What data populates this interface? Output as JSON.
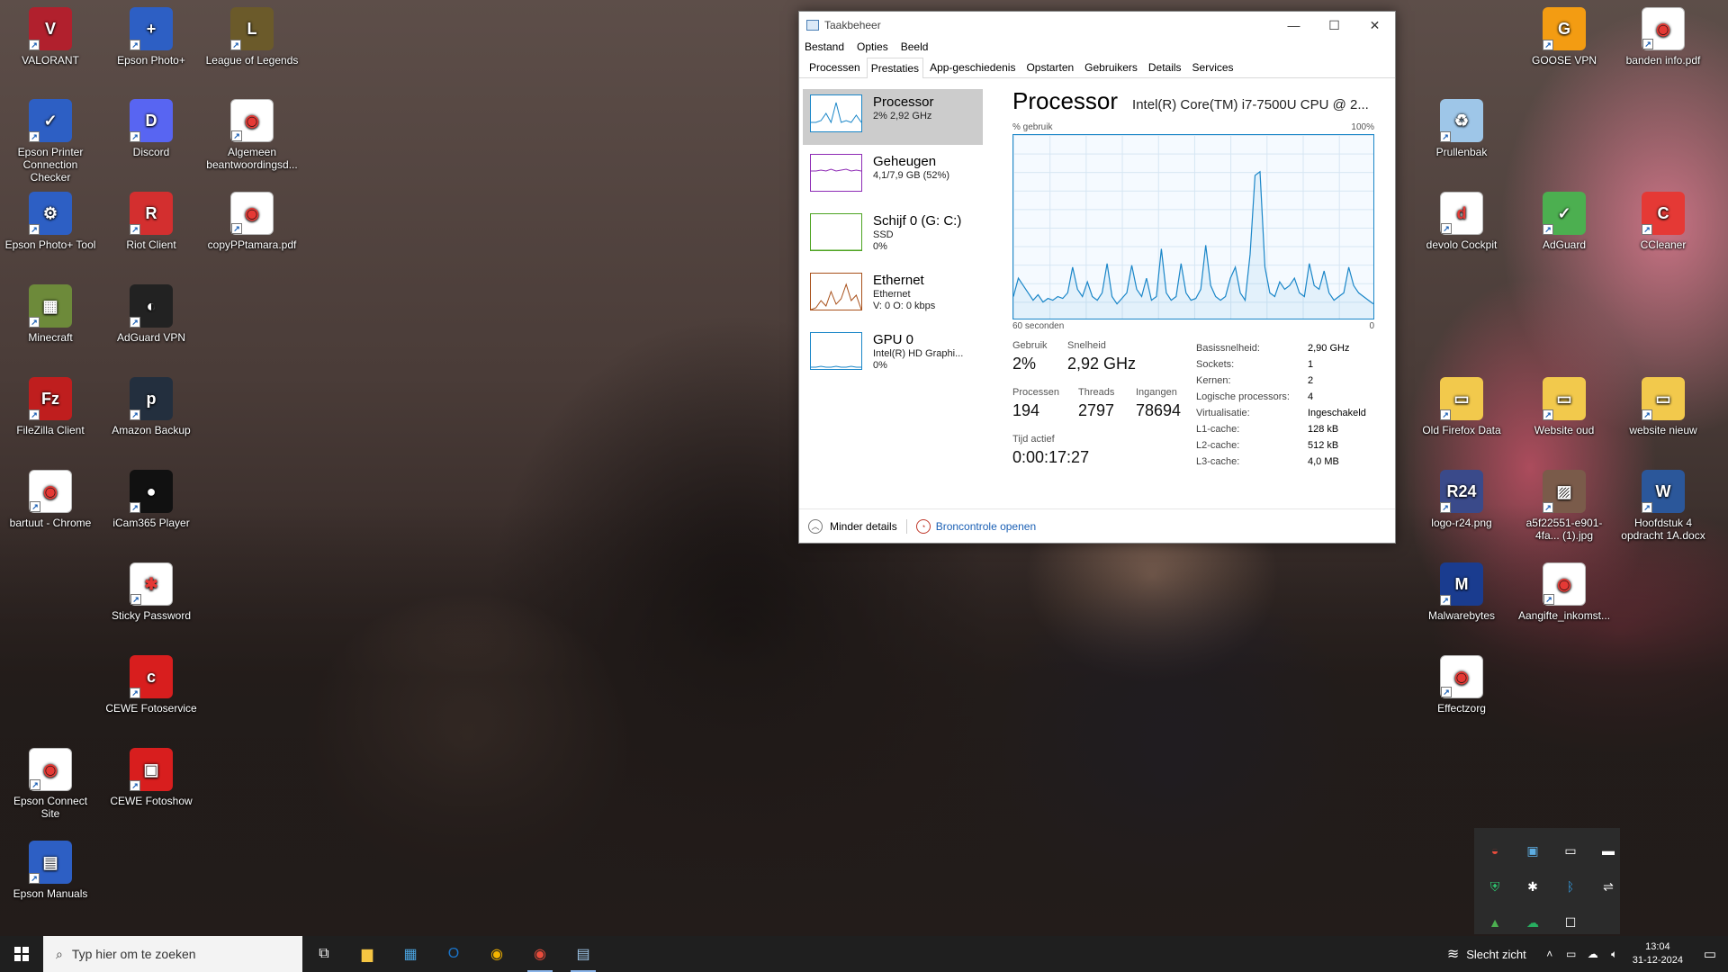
{
  "desktop": {
    "icons": [
      {
        "label": "VALORANT",
        "color": "#b1202d",
        "glyph": "V"
      },
      {
        "label": "Epson Photo+",
        "color": "#2d5fc4",
        "glyph": "+"
      },
      {
        "label": "League of Legends",
        "color": "#6b5a2a",
        "glyph": "L"
      },
      {
        "label": "Epson Printer Connection Checker",
        "color": "#2d5fc4",
        "glyph": "✓"
      },
      {
        "label": "Discord",
        "color": "#5865f2",
        "glyph": "D"
      },
      {
        "label": "Algemeen beantwoordingsd...",
        "color": "#ffffff",
        "glyph": "◉"
      },
      {
        "label": "Epson Photo+ Tool",
        "color": "#2d5fc4",
        "glyph": "⚙"
      },
      {
        "label": "Riot Client",
        "color": "#d32f2f",
        "glyph": "R"
      },
      {
        "label": "copyPPtamara.pdf",
        "color": "#ffffff",
        "glyph": "◉"
      },
      {
        "label": "Minecraft",
        "color": "#6d8a3a",
        "glyph": "▦"
      },
      {
        "label": "AdGuard VPN",
        "color": "#222222",
        "glyph": "◐"
      },
      {
        "label": "FileZilla Client",
        "color": "#bf1e1e",
        "glyph": "Fz"
      },
      {
        "label": "Amazon Backup",
        "color": "#232f3e",
        "glyph": "p"
      },
      {
        "label": "bartuut - Chrome",
        "color": "#ffffff",
        "glyph": "◉"
      },
      {
        "label": "iCam365 Player",
        "color": "#111111",
        "glyph": "●"
      },
      {
        "label": "Sticky Password",
        "color": "#ffffff",
        "glyph": "✱"
      },
      {
        "label": "CEWE Fotoservice",
        "color": "#d81e1e",
        "glyph": "c"
      },
      {
        "label": "Epson Connect Site",
        "color": "#ffffff",
        "glyph": "◉"
      },
      {
        "label": "CEWE Fotoshow",
        "color": "#d81e1e",
        "glyph": "▣"
      },
      {
        "label": "Epson Manuals",
        "color": "#2d5fc4",
        "glyph": "▤"
      },
      {
        "label": "GOOSE VPN",
        "color": "#f39c12",
        "glyph": "G"
      },
      {
        "label": "banden info.pdf",
        "color": "#ffffff",
        "glyph": "◉"
      },
      {
        "label": "Prullenbak",
        "color": "#9ec6e8",
        "glyph": "♻"
      },
      {
        "label": "devolo Cockpit",
        "color": "#ffffff",
        "glyph": "d"
      },
      {
        "label": "AdGuard",
        "color": "#4caf50",
        "glyph": "✓"
      },
      {
        "label": "CCleaner",
        "color": "#e53935",
        "glyph": "C"
      },
      {
        "label": "Old Firefox Data",
        "color": "#f2c94c",
        "glyph": "▭"
      },
      {
        "label": "Website oud",
        "color": "#f2c94c",
        "glyph": "▭"
      },
      {
        "label": "website nieuw",
        "color": "#f2c94c",
        "glyph": "▭"
      },
      {
        "label": "logo-r24.png",
        "color": "#3a4a8a",
        "glyph": "R24"
      },
      {
        "label": "a5f22551-e901-4fa... (1).jpg",
        "color": "#7a5b4a",
        "glyph": "▨"
      },
      {
        "label": "Hoofdstuk 4 opdracht 1A.docx",
        "color": "#2b579a",
        "glyph": "W"
      },
      {
        "label": "Malwarebytes",
        "color": "#1a3c8f",
        "glyph": "M"
      },
      {
        "label": "Aangifte_inkomst...",
        "color": "#ffffff",
        "glyph": "◉"
      },
      {
        "label": "Effectzorg",
        "color": "#ffffff",
        "glyph": "◉"
      }
    ]
  },
  "taskmanager": {
    "title": "Taakbeheer",
    "menu": [
      "Bestand",
      "Opties",
      "Beeld"
    ],
    "tabs": [
      "Processen",
      "Prestaties",
      "App-geschiedenis",
      "Opstarten",
      "Gebruikers",
      "Details",
      "Services"
    ],
    "active_tab": "Prestaties",
    "sidebar": [
      {
        "name": "Processor",
        "sub1": "2% 2,92 GHz",
        "sub2": "",
        "sub3": "",
        "color": "#1a86c8"
      },
      {
        "name": "Geheugen",
        "sub1": "4,1/7,9 GB (52%)",
        "sub2": "",
        "sub3": "",
        "color": "#8e2bb5"
      },
      {
        "name": "Schijf 0 (G: C:)",
        "sub1": "SSD",
        "sub2": "0%",
        "sub3": "",
        "color": "#4da321"
      },
      {
        "name": "Ethernet",
        "sub1": "Ethernet",
        "sub2": "V: 0 O: 0 kbps",
        "sub3": "",
        "color": "#a8501a"
      },
      {
        "name": "GPU 0",
        "sub1": "Intel(R) HD Graphi...",
        "sub2": "0%",
        "sub3": "",
        "color": "#1a86c8"
      }
    ],
    "panel": {
      "title": "Processor",
      "model": "Intel(R) Core(TM) i7-7500U CPU @ 2...",
      "axis_top_left": "% gebruik",
      "axis_top_right": "100%",
      "axis_bottom_left": "60 seconden",
      "axis_bottom_right": "0",
      "stats": {
        "gebruik_label": "Gebruik",
        "gebruik": "2%",
        "snelheid_label": "Snelheid",
        "snelheid": "2,92 GHz",
        "processen_label": "Processen",
        "processen": "194",
        "threads_label": "Threads",
        "threads": "2797",
        "ingangen_label": "Ingangen",
        "ingangen": "78694",
        "tijd_label": "Tijd actief",
        "tijd": "0:00:17:27"
      },
      "specs": [
        {
          "k": "Basissnelheid:",
          "v": "2,90 GHz"
        },
        {
          "k": "Sockets:",
          "v": "1"
        },
        {
          "k": "Kernen:",
          "v": "2"
        },
        {
          "k": "Logische processors:",
          "v": "4"
        },
        {
          "k": "Virtualisatie:",
          "v": "Ingeschakeld"
        },
        {
          "k": "L1-cache:",
          "v": "128 kB"
        },
        {
          "k": "L2-cache:",
          "v": "512 kB"
        },
        {
          "k": "L3-cache:",
          "v": "4,0 MB"
        }
      ]
    },
    "footer": {
      "fewer": "Minder details",
      "resmon": "Broncontrole openen"
    }
  },
  "chart_data": {
    "type": "line",
    "ylim": [
      0,
      100
    ],
    "xlim": [
      60,
      0
    ],
    "series": [
      {
        "values": [
          12,
          22,
          18,
          14,
          10,
          13,
          9,
          11,
          10,
          12,
          11,
          14,
          28,
          16,
          12,
          20,
          12,
          10,
          14,
          30,
          12,
          8,
          11,
          14,
          29,
          16,
          12,
          22,
          10,
          12,
          38,
          14,
          10,
          12,
          30,
          14,
          10,
          11,
          16,
          40,
          18,
          12,
          10,
          12,
          22,
          28,
          14,
          10,
          35,
          78,
          80,
          28,
          14,
          12,
          20,
          16,
          18,
          22,
          14,
          12,
          30,
          18,
          16,
          26,
          14,
          10,
          12,
          14,
          28,
          18,
          14,
          12,
          10,
          8
        ]
      }
    ]
  },
  "tray_popup": [
    "steam-like",
    "network-manager",
    "monitor",
    "battery",
    "defender",
    "sticky-password",
    "bluetooth",
    "usb",
    "drive",
    "cloud",
    "window"
  ],
  "taskbar": {
    "search_placeholder": "Typ hier om te zoeken",
    "weather": "Slecht zicht",
    "time": "13:04",
    "date": "31-12-2024"
  }
}
